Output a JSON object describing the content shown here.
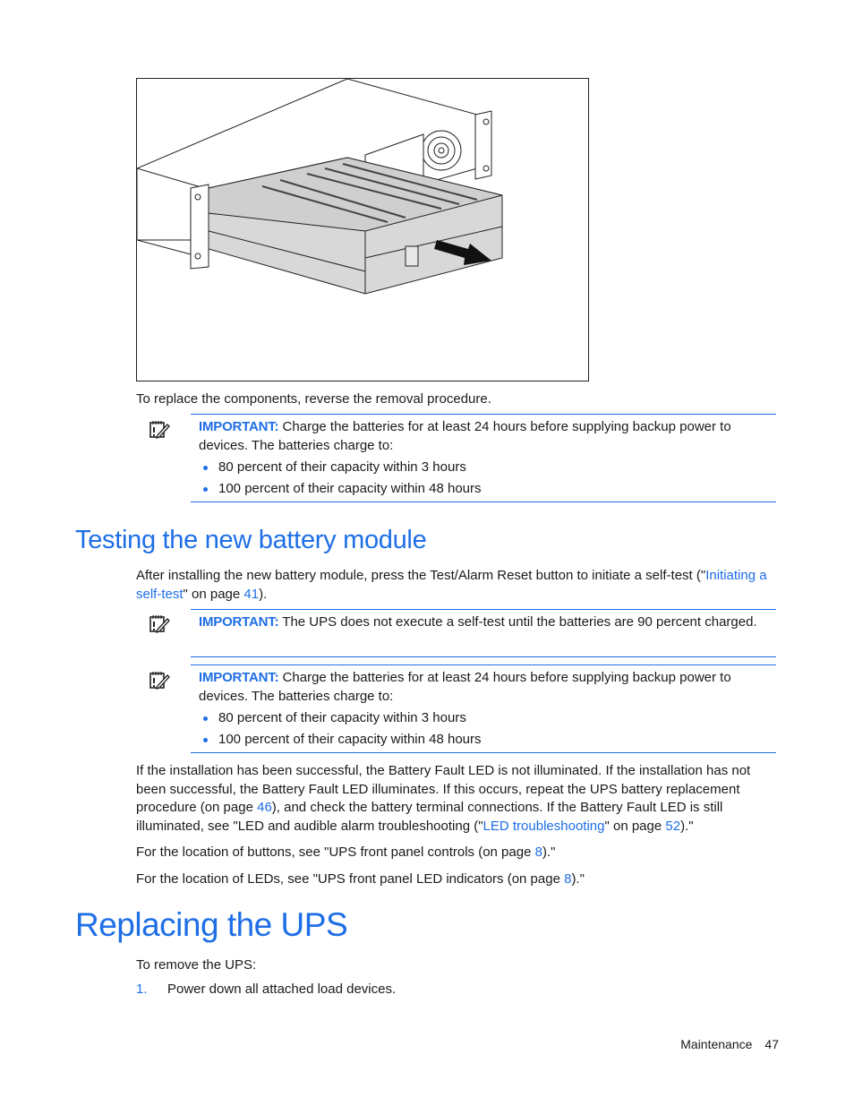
{
  "figure": {
    "alt": "UPS battery module being pulled out of rack-mounted UPS chassis, arrow indicating removal direction"
  },
  "reverse_note": "To replace the components, reverse the removal procedure.",
  "note1": {
    "icon": "important-notepad-icon",
    "label": "IMPORTANT:",
    "text": " Charge the batteries for at least 24 hours before supplying backup power to devices. The batteries charge to:",
    "bullets": [
      "80 percent of their capacity within 3 hours",
      "100 percent of their capacity within 48 hours"
    ]
  },
  "section_testing": {
    "heading": "Testing the new battery module",
    "intro_before": "After installing the new battery module, press the Test/Alarm Reset button to initiate a self-test (\"",
    "intro_link": "Initiating a self-test",
    "intro_middle": "\" on page ",
    "intro_page": "41",
    "intro_after": ")."
  },
  "note2": {
    "icon": "important-notepad-icon",
    "label": "IMPORTANT:",
    "text": " The UPS does not execute a self-test until the batteries are 90 percent charged."
  },
  "note3": {
    "icon": "important-notepad-icon",
    "label": "IMPORTANT:",
    "text": " Charge the batteries for at least 24 hours before supplying backup power to devices. The batteries charge to:",
    "bullets": [
      "80 percent of their capacity within 3 hours",
      "100 percent of their capacity within 48 hours"
    ]
  },
  "result_para": {
    "p1": "If the installation has been successful, the Battery Fault LED is not illuminated. If the installation has not been successful, the Battery Fault LED illuminates. If this occurs, repeat the UPS battery replacement procedure (on page ",
    "page1": "46",
    "p2": "), and check the battery terminal connections. If the Battery Fault LED is still illuminated, see \"LED and audible alarm troubleshooting (\"",
    "link2": "LED troubleshooting",
    "p3": "\" on page ",
    "page2": "52",
    "p4": ").\""
  },
  "buttons_para": {
    "before": "For the location of buttons, see \"UPS front panel controls (on page ",
    "page": "8",
    "after": ").\""
  },
  "leds_para": {
    "before": "For the location of LEDs, see \"UPS front panel LED indicators (on page ",
    "page": "8",
    "after": ").\""
  },
  "section_replacing": {
    "heading": "Replacing the UPS",
    "intro": "To remove the UPS:",
    "steps": [
      {
        "num": "1.",
        "text": "Power down all attached load devices."
      }
    ]
  },
  "footer": {
    "section": "Maintenance",
    "page": "47"
  }
}
